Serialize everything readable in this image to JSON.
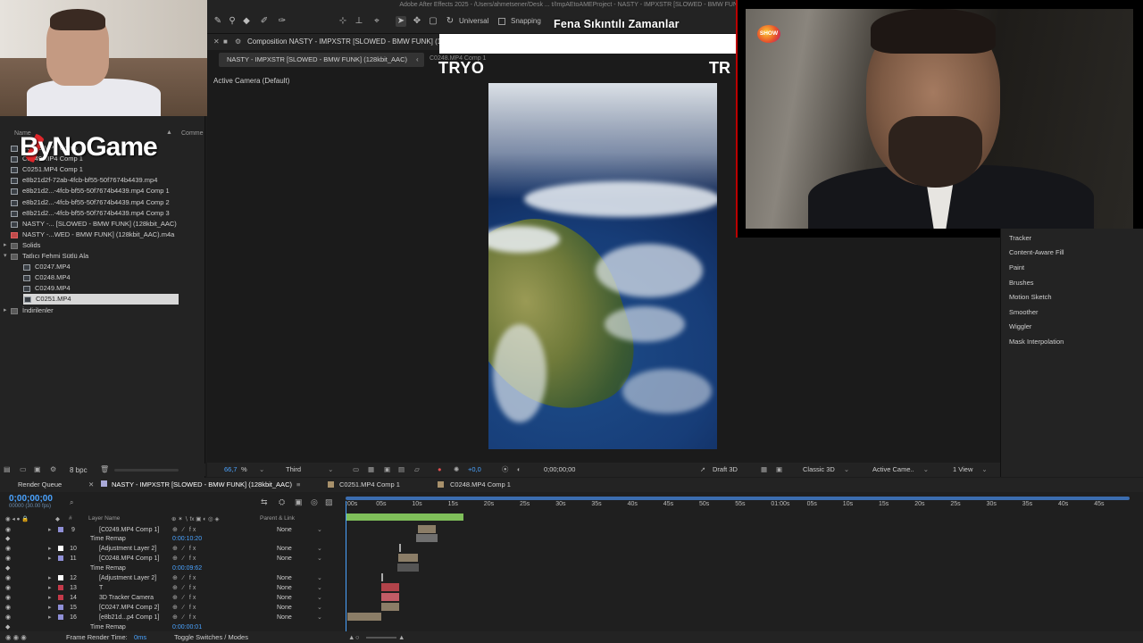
{
  "app": {
    "title_bar": "Adobe After Effects 2025 - /Users/ahmetsener/Desk ... t/ImpAEtoAMEProject - NASTY - IMPXSTR [SLOWED - BMW FUNK]"
  },
  "toolbar": {
    "universal_label": "Universal",
    "snapping_label": "Snapping"
  },
  "overlay": {
    "show_title": "Fena Sıkıntılı Zamanlar",
    "tryo_left": "TRYO",
    "tryo_right": "TR",
    "tv_logo": "SHOW",
    "streamer_logo": "ByNoGame"
  },
  "composition": {
    "tab_label": "Composition NASTY - IMPXSTR [SLOWED - BMW FUNK] (128",
    "subtab_active": "NASTY - IMPXSTR [SLOWED - BMW FUNK] (128kbit_AAC)",
    "subtab_next": "C0248.MP4 Comp 1",
    "active_camera": "Active Camera (Default)"
  },
  "project": {
    "col_name": "Name",
    "col_comment": "Comme",
    "items": [
      {
        "label": "C0248.MP4 Comp",
        "type": "comp",
        "indent": 0
      },
      {
        "label": "C0249.MP4 Comp 1",
        "type": "comp",
        "indent": 0
      },
      {
        "label": "C0251.MP4 Comp 1",
        "type": "comp",
        "indent": 0
      },
      {
        "label": "e8b21d2f-72ab-4fcb-bf55-50f7674b4439.mp4",
        "type": "comp",
        "indent": 0
      },
      {
        "label": "e8b21d2...-4fcb-bf55-50f7674b4439.mp4 Comp 1",
        "type": "comp",
        "indent": 0
      },
      {
        "label": "e8b21d2...-4fcb-bf55-50f7674b4439.mp4 Comp 2",
        "type": "comp",
        "indent": 0
      },
      {
        "label": "e8b21d2...-4fcb-bf55-50f7674b4439.mp4 Comp 3",
        "type": "comp",
        "indent": 0
      },
      {
        "label": "NASTY -... [SLOWED - BMW FUNK] (128kbit_AAC)",
        "type": "comp",
        "indent": 0
      },
      {
        "label": "NASTY -...WED - BMW FUNK] (128kbit_AAC).m4a",
        "type": "audio",
        "indent": 0
      },
      {
        "label": "Solids",
        "type": "folder",
        "indent": 0
      },
      {
        "label": "Tatlıcı Fehmi Sütlü Ala",
        "type": "folder-open",
        "indent": 0
      },
      {
        "label": "C0247.MP4",
        "type": "footage",
        "indent": 1
      },
      {
        "label": "C0248.MP4",
        "type": "footage",
        "indent": 1
      },
      {
        "label": "C0249.MP4",
        "type": "footage",
        "indent": 1
      },
      {
        "label": "C0251.MP4",
        "type": "footage",
        "indent": 1,
        "selected": true
      },
      {
        "label": "İndirilenler",
        "type": "folder",
        "indent": 0
      }
    ],
    "bpc": "8 bpc"
  },
  "right_panel": {
    "items": [
      "Tracker",
      "Content-Aware Fill",
      "Paint",
      "Brushes",
      "Motion Sketch",
      "Smoother",
      "Wiggler",
      "Mask Interpolation"
    ]
  },
  "comp_footer": {
    "zoom": "66,7",
    "zoom_unit": "%",
    "resolution": "Third",
    "exposure": "+0,0",
    "timecode": "0;00;00;00",
    "draft3d": "Draft 3D",
    "renderer": "Classic 3D",
    "camera": "Active Came..",
    "views": "1 View"
  },
  "timeline": {
    "tabs": {
      "render_queue": "Render Queue",
      "active": "NASTY - IMPXSTR [SLOWED - BMW FUNK] (128kbit_AAC)",
      "comp2": "C0251.MP4 Comp 1",
      "comp3": "C0248.MP4 Comp 1"
    },
    "timecode": "0;00;00;00",
    "fps": "00000 (30.00 fps)",
    "head_layer_name": "Layer Name",
    "head_parent": "Parent & Link",
    "ruler": [
      ":00s",
      "05s",
      "10s",
      "15s",
      "20s",
      "25s",
      "30s",
      "35s",
      "40s",
      "45s",
      "50s",
      "55s",
      "01:00s",
      "05s",
      "10s",
      "15s",
      "20s",
      "25s",
      "30s",
      "35s",
      "40s",
      "45s"
    ],
    "layers": [
      {
        "num": "9",
        "name": "[C0249.MP4 Comp 1]",
        "parent": "None",
        "color": "#8f8fd6",
        "kind": "layer"
      },
      {
        "num": "",
        "name": "Time Remap",
        "value": "0:00:10:20",
        "kind": "sub"
      },
      {
        "num": "10",
        "name": "[Adjustment Layer 2]",
        "parent": "None",
        "color": "#ffffff",
        "kind": "layer"
      },
      {
        "num": "11",
        "name": "[C0248.MP4 Comp 1]",
        "parent": "None",
        "color": "#8f8fd6",
        "kind": "layer"
      },
      {
        "num": "",
        "name": "Time Remap",
        "value": "0:00:09:62",
        "kind": "sub"
      },
      {
        "num": "12",
        "name": "[Adjustment Layer 2]",
        "parent": "None",
        "color": "#ffffff",
        "kind": "layer"
      },
      {
        "num": "13",
        "name": "T",
        "parent": "None",
        "color": "#c43a4a",
        "kind": "layer"
      },
      {
        "num": "14",
        "name": "3D Tracker Camera",
        "parent": "None",
        "color": "#c43a4a",
        "kind": "layer"
      },
      {
        "num": "15",
        "name": "[C0247.MP4 Comp 2]",
        "parent": "None",
        "color": "#8f8fd6",
        "kind": "layer"
      },
      {
        "num": "16",
        "name": "[e8b21d...p4 Comp 1]",
        "parent": "None",
        "color": "#8f8fd6",
        "kind": "layer"
      },
      {
        "num": "",
        "name": "Time Remap",
        "value": "0:00:00:01",
        "kind": "sub"
      }
    ],
    "footer_render": "Frame Render Time:",
    "footer_render_val": "0ms",
    "footer_toggle": "Toggle Switches / Modes"
  }
}
